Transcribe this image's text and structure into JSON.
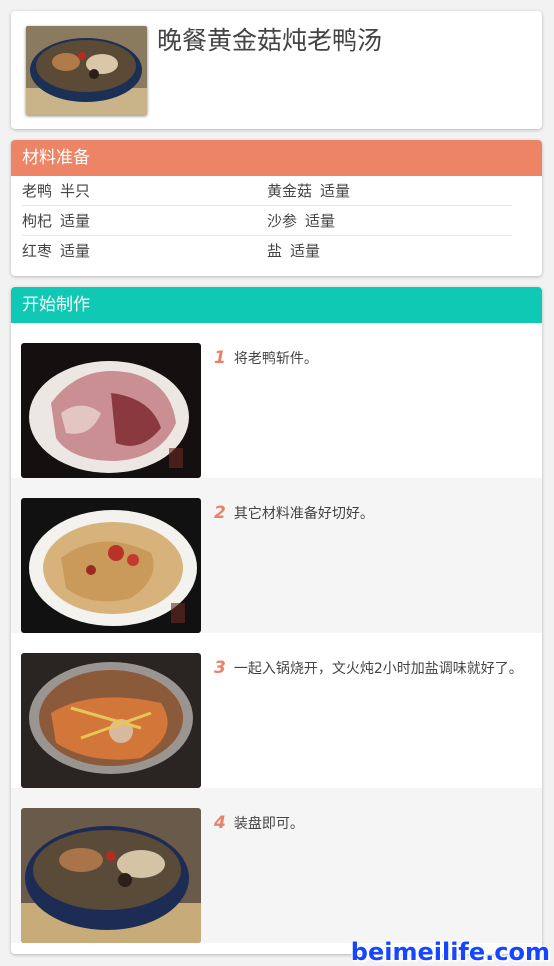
{
  "recipe": {
    "title": "晚餐黄金菇炖老鸭汤"
  },
  "ingredients": {
    "heading": "材料准备",
    "rows": [
      [
        {
          "name": "老鸭",
          "qty": "半只"
        },
        {
          "name": "黄金菇",
          "qty": "适量"
        }
      ],
      [
        {
          "name": "枸杞",
          "qty": "适量"
        },
        {
          "name": "沙参",
          "qty": "适量"
        }
      ],
      [
        {
          "name": "红枣",
          "qty": "适量"
        },
        {
          "name": "盐",
          "qty": "适量"
        }
      ]
    ]
  },
  "steps": {
    "heading": "开始制作",
    "items": [
      {
        "num": "1",
        "text": "将老鸭斩件。"
      },
      {
        "num": "2",
        "text": "其它材料准备好切好。"
      },
      {
        "num": "3",
        "text": "一起入锅烧开，文火炖2小时加盐调味就好了。"
      },
      {
        "num": "4",
        "text": "装盘即可。"
      }
    ]
  },
  "colors": {
    "ingredients_bar": "#ee8466",
    "steps_bar": "#10c9b4",
    "step_number": "#e8826a",
    "watermark": "#1447ff"
  },
  "watermark": "beimeilife.com"
}
